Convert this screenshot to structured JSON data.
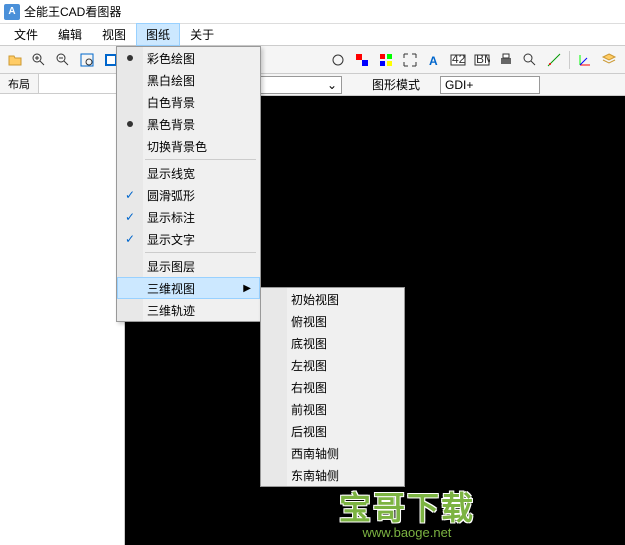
{
  "window": {
    "title": "全能王CAD看图器"
  },
  "menubar": [
    "文件",
    "编辑",
    "视图",
    "图纸",
    "关于"
  ],
  "active_menu_index": 3,
  "sidebar": {
    "tab": "布局"
  },
  "subtoolbar": {
    "mode_label": "图形模式",
    "mode_value": "GDI+"
  },
  "dropdown": {
    "items": [
      {
        "label": "彩色绘图",
        "radio": true
      },
      {
        "label": "黑白绘图"
      },
      {
        "label": "白色背景"
      },
      {
        "label": "黑色背景",
        "radio": true
      },
      {
        "label": "切换背景色"
      },
      {
        "sep": true
      },
      {
        "label": "显示线宽"
      },
      {
        "label": "圆滑弧形",
        "check": true
      },
      {
        "label": "显示标注",
        "check": true
      },
      {
        "label": "显示文字",
        "check": true
      },
      {
        "sep": true
      },
      {
        "label": "显示图层"
      },
      {
        "label": "三维视图",
        "submenu": true,
        "highlighted": true
      },
      {
        "label": "三维轨迹"
      }
    ]
  },
  "submenu": {
    "items": [
      "初始视图",
      "俯视图",
      "底视图",
      "左视图",
      "右视图",
      "前视图",
      "后视图",
      "西南轴侧",
      "东南轴侧"
    ]
  },
  "watermark": {
    "text": "宝哥下载",
    "url": "www.baoge.net"
  }
}
